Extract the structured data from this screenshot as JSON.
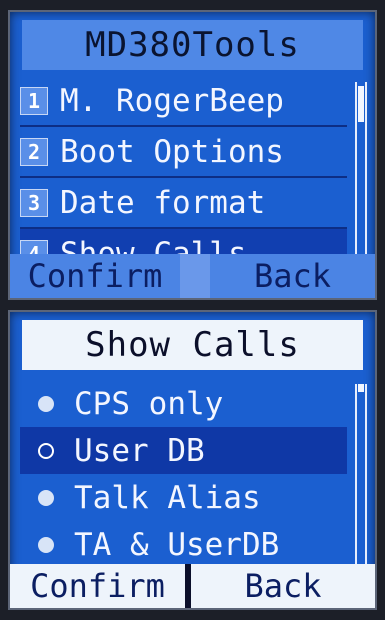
{
  "screen_main": {
    "title": "MD380Tools",
    "items": [
      {
        "num": "1",
        "label": "M. RogerBeep"
      },
      {
        "num": "2",
        "label": "Boot Options"
      },
      {
        "num": "3",
        "label": "Date format"
      },
      {
        "num": "4",
        "label": "Show Calls"
      }
    ],
    "selected_index": 3,
    "softkeys": {
      "left": "Confirm",
      "right": "Back"
    }
  },
  "screen_show_calls": {
    "title": "Show Calls",
    "options": [
      {
        "label": "CPS only"
      },
      {
        "label": "User DB"
      },
      {
        "label": "Talk Alias"
      },
      {
        "label": "TA & UserDB"
      }
    ],
    "selected_index": 1,
    "softkeys": {
      "left": "Confirm",
      "right": "Back"
    }
  },
  "colors": {
    "screen_bg": "#1b5fd0",
    "highlight": "#113fb0",
    "title_bar_main": "#4f88e6",
    "title_bar_sub": "#eef4fb"
  }
}
